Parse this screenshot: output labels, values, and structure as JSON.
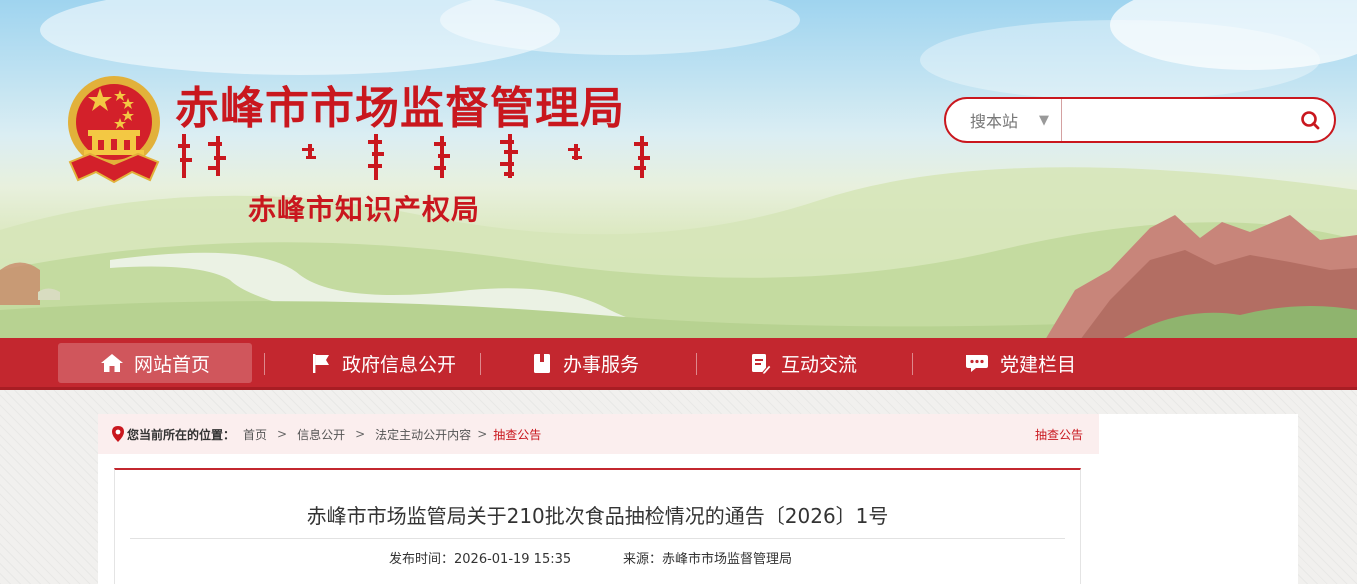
{
  "header": {
    "title": "赤峰市市场监督管理局",
    "subtitle": "赤峰市知识产权局",
    "emblem_icon": "national-emblem-icon",
    "brand_color": "#c9171e"
  },
  "search": {
    "scope_label": "搜本站",
    "scope_arrow": "▼",
    "placeholder": "",
    "button_icon": "search-icon"
  },
  "nav": {
    "bg_color": "#c3272f",
    "items": [
      {
        "label": "网站首页",
        "icon": "home-icon",
        "active": true
      },
      {
        "label": "政府信息公开",
        "icon": "flag-icon",
        "active": false
      },
      {
        "label": "办事服务",
        "icon": "document-icon",
        "active": false
      },
      {
        "label": "互动交流",
        "icon": "edit-document-icon",
        "active": false
      },
      {
        "label": "党建栏目",
        "icon": "chat-icon",
        "active": false
      }
    ]
  },
  "breadcrumb": {
    "label": "您当前所在的位置：",
    "items": [
      "首页",
      "信息公开",
      "法定主动公开内容",
      "抽查公告"
    ],
    "category": "抽查公告"
  },
  "article": {
    "title": "赤峰市市场监管局关于210批次食品抽检情况的通告〔2026〕1号",
    "publish_time": "发布时间：2026-01-19 15:35",
    "source": "来源：赤峰市市场监督管理局"
  }
}
